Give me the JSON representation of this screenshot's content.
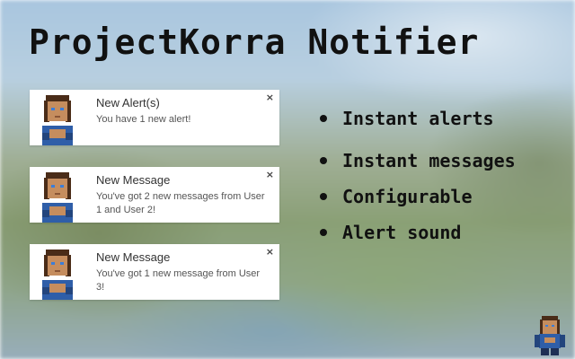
{
  "app": {
    "title": "ProjectKorra Notifier"
  },
  "notifications": [
    {
      "title": "New Alert(s)",
      "body": "You have 1 new alert!",
      "close": "×",
      "icon": "player-avatar-icon"
    },
    {
      "title": "New Message",
      "body": "You've got 2 new messages from User 1 and User 2!",
      "close": "×",
      "icon": "player-avatar-icon"
    },
    {
      "title": "New Message",
      "body": "You've got 1 new message from User 3!",
      "close": "×",
      "icon": "player-avatar-icon"
    }
  ],
  "features": [
    "Instant alerts",
    "Instant messages",
    "Configurable",
    "Alert sound"
  ],
  "colors": {
    "title_text": "#111111",
    "card_background": "#ffffff",
    "avatar_shirt": "#2f5ea8",
    "avatar_skin": "#c58d5e"
  }
}
